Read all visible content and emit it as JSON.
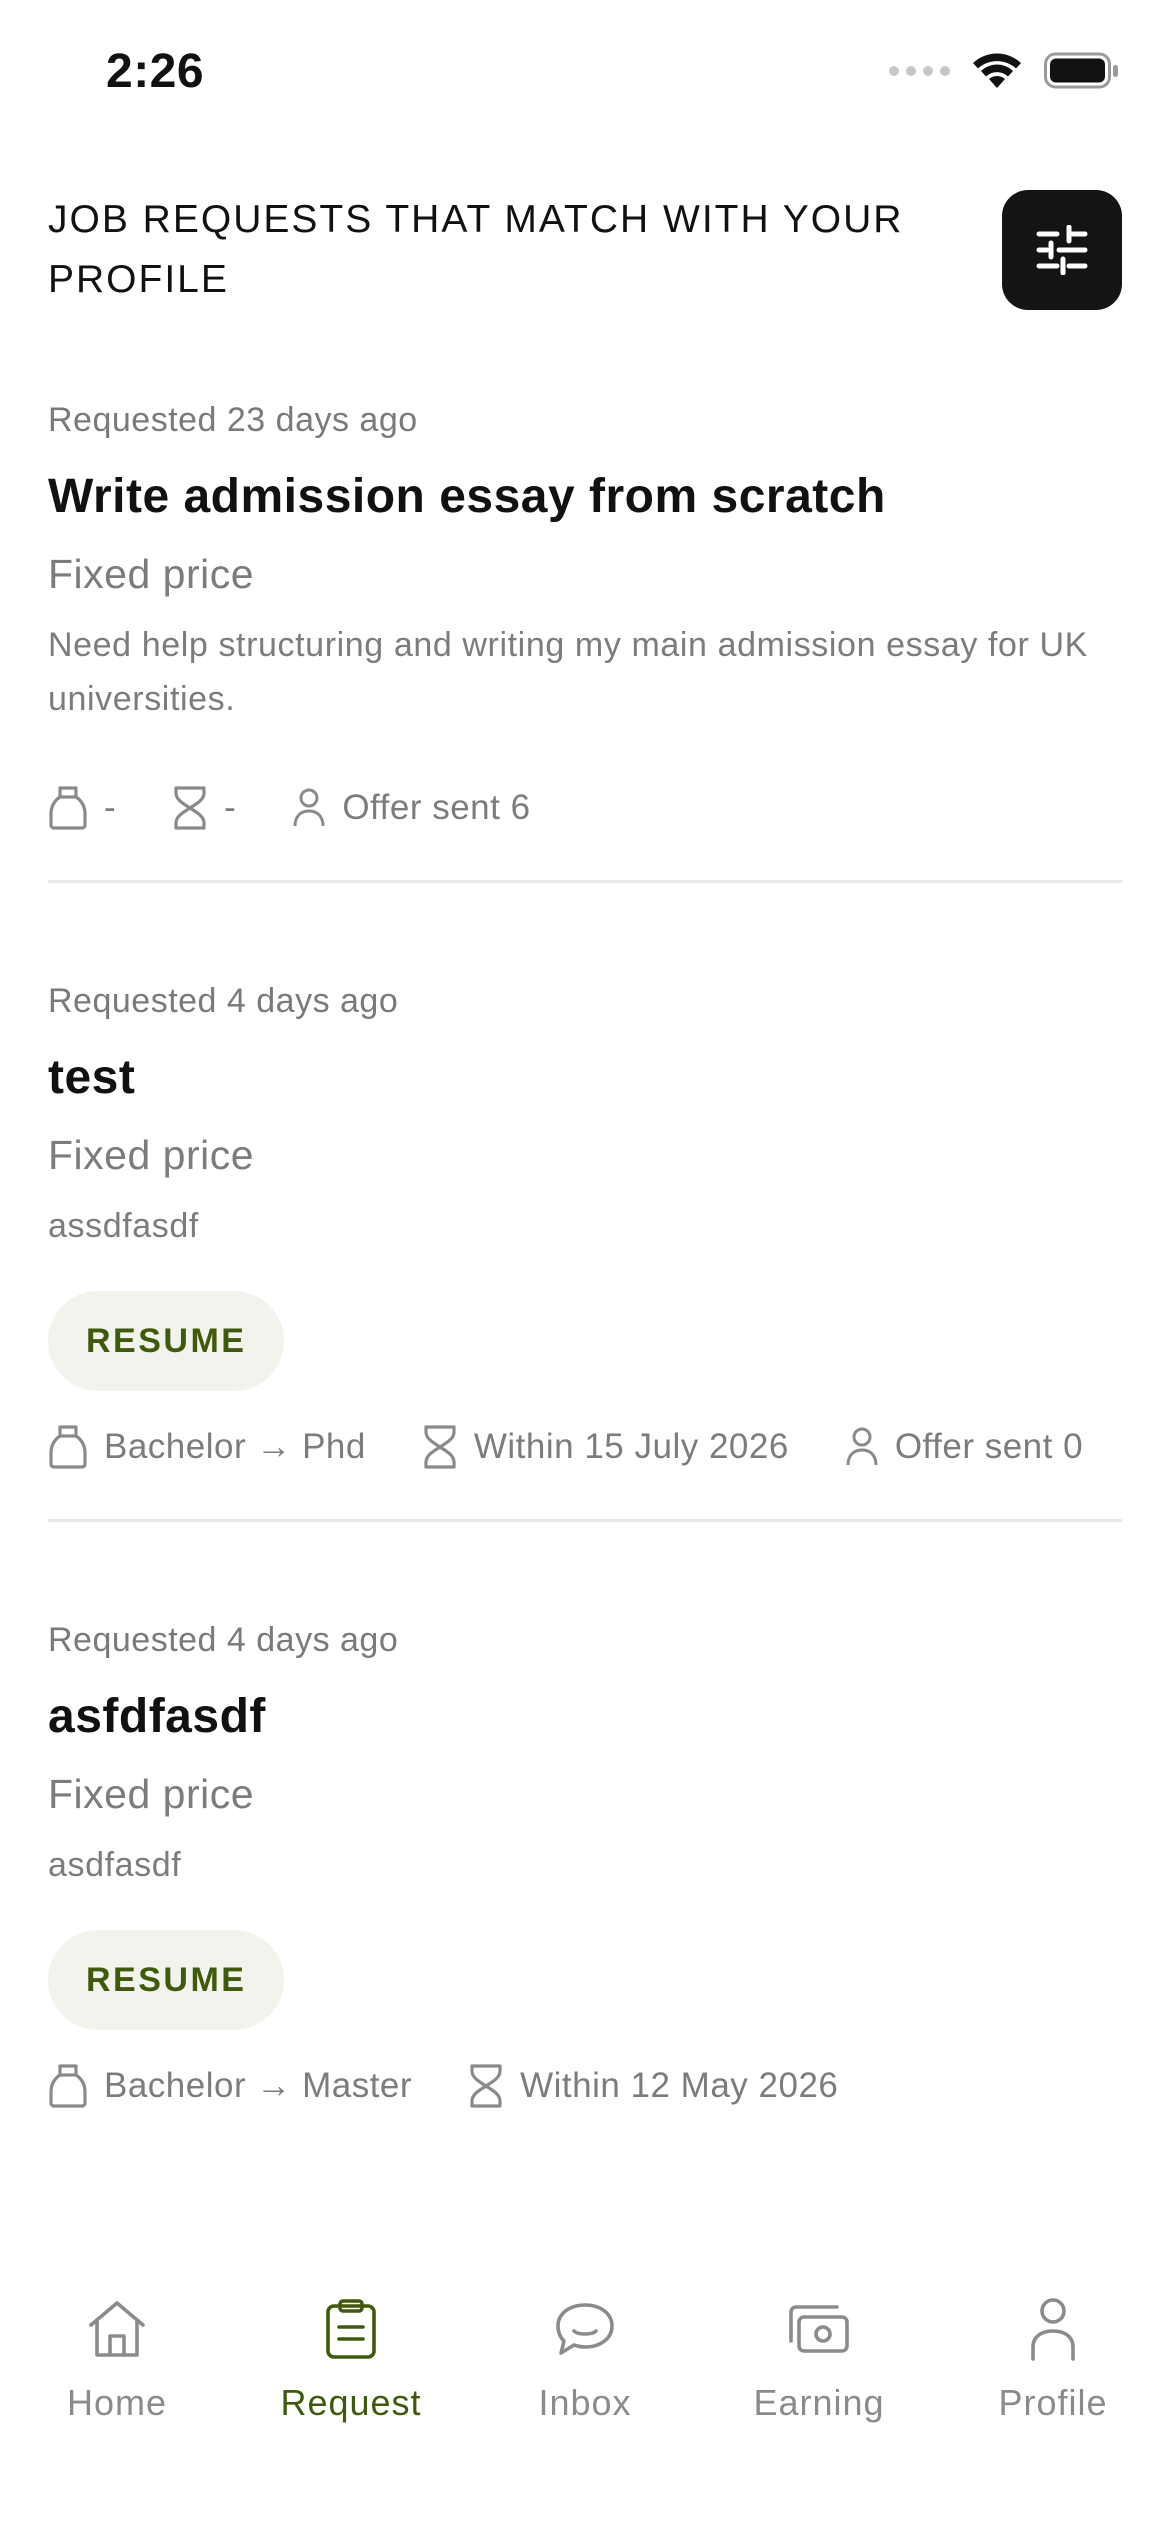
{
  "status_bar": {
    "time": "2:26"
  },
  "header": {
    "title": "JOB REQUESTS THAT MATCH WITH YOUR PROFILE"
  },
  "requests": [
    {
      "requested": "Requested 23 days ago",
      "title": "Write admission essay from scratch",
      "price_type": "Fixed price",
      "description": "Need help structuring and writing my main admission essay for UK universities.",
      "resume_label": "",
      "degree": "-",
      "deadline": "-",
      "offers": "Offer sent 6"
    },
    {
      "requested": "Requested 4 days ago",
      "title": "test",
      "price_type": "Fixed price",
      "description": "assdfasdf",
      "resume_label": "RESUME",
      "degree": "Bachelor → Phd",
      "deadline": "Within 15 July 2026",
      "offers": "Offer sent 0"
    },
    {
      "requested": "Requested 4 days ago",
      "title": "asfdfasdf",
      "price_type": "Fixed price",
      "description": "asdfasdf",
      "resume_label": "RESUME",
      "degree": "Bachelor → Master",
      "deadline": "Within 12 May 2026",
      "offers": ""
    }
  ],
  "tabs": [
    {
      "label": "Home",
      "icon": "home-icon"
    },
    {
      "label": "Request",
      "icon": "clipboard-icon"
    },
    {
      "label": "Inbox",
      "icon": "chat-bubble-icon"
    },
    {
      "label": "Earning",
      "icon": "cash-icon"
    },
    {
      "label": "Profile",
      "icon": "person-icon"
    }
  ],
  "colors": {
    "accent": "#3F5A0A",
    "badge_bg": "#F1F3EC",
    "filter_button": "#141414",
    "muted_text": "#7C7C7C"
  }
}
